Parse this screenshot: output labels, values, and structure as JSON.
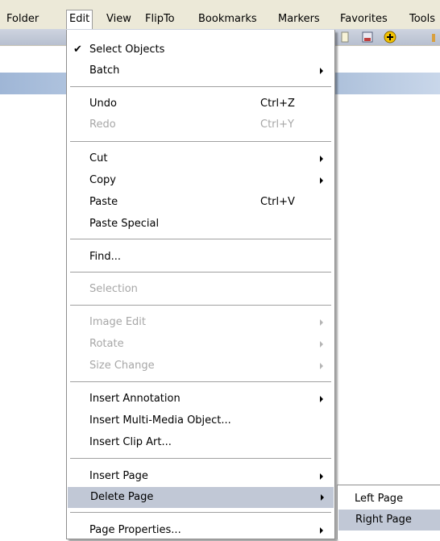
{
  "menubar": {
    "items": [
      {
        "label": "Folder"
      },
      {
        "label": "Edit"
      },
      {
        "label": "View"
      },
      {
        "label": "FlipTo"
      },
      {
        "label": "Bookmarks"
      },
      {
        "label": "Markers"
      },
      {
        "label": "Favorites"
      },
      {
        "label": "Tools"
      }
    ],
    "active": "Edit"
  },
  "toolbar": {
    "icons": [
      "page-icon",
      "save-image-icon",
      "add-icon",
      "tool-icon"
    ]
  },
  "edit_menu": {
    "items": [
      {
        "label": "Select Objects",
        "checked": true
      },
      {
        "label": "Batch",
        "submenu": true
      },
      {
        "label": "Undo",
        "shortcut": "Ctrl+Z"
      },
      {
        "label": "Redo",
        "shortcut": "Ctrl+Y",
        "disabled": true
      },
      {
        "label": "Cut",
        "submenu": true
      },
      {
        "label": "Copy",
        "submenu": true
      },
      {
        "label": "Paste",
        "shortcut": "Ctrl+V"
      },
      {
        "label": "Paste Special"
      },
      {
        "label": "Find..."
      },
      {
        "label": "Selection",
        "disabled": true
      },
      {
        "label": "Image Edit",
        "submenu": true,
        "disabled": true
      },
      {
        "label": "Rotate",
        "submenu": true,
        "disabled": true
      },
      {
        "label": "Size Change",
        "submenu": true,
        "disabled": true
      },
      {
        "label": "Insert Annotation",
        "submenu": true
      },
      {
        "label": "Insert Multi-Media Object..."
      },
      {
        "label": "Insert Clip Art..."
      },
      {
        "label": "Insert Page",
        "submenu": true
      },
      {
        "label": "Delete Page",
        "submenu": true,
        "highlighted": true
      },
      {
        "label": "Page Properties...",
        "submenu": true
      }
    ]
  },
  "delete_page_submenu": {
    "items": [
      {
        "label": "Left Page"
      },
      {
        "label": "Right Page",
        "highlighted": true
      }
    ]
  },
  "colors": {
    "menubar_bg": "#ece9d8",
    "highlight": "#c1c8d6",
    "disabled_text": "#a7a7a7"
  }
}
